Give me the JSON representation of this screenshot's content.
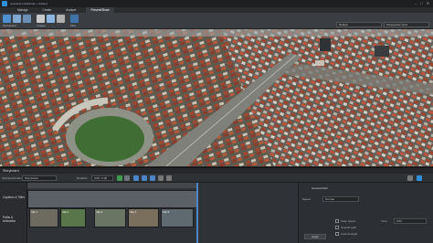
{
  "app": {
    "title": "Autodesk InfraWorks - Untitled"
  },
  "window_controls": [
    "–",
    "□",
    "✕"
  ],
  "ribbon": {
    "tabs": [
      {
        "label": "Manage",
        "active": false
      },
      {
        "label": "Create",
        "active": false
      },
      {
        "label": "Analyze",
        "active": false
      },
      {
        "label": "Present/Share",
        "active": true
      }
    ],
    "groups": [
      "Storyboard",
      "Images",
      "Misc"
    ],
    "style_select": "Default",
    "view_select": "Perspective View",
    "accent": "#2f8fd8"
  },
  "storyboard": {
    "title": "Storyboard",
    "name_label": "Storyboard Name:",
    "name_value": "Storyboard",
    "duration_label": "Duration:",
    "duration_value": "0:00 / 0:00",
    "tracks": [
      "Captions & Titles",
      "Paths & Animation"
    ],
    "thumb_labels": [
      "Clip 1",
      "Clip 2",
      "Clip 3",
      "Clip 4",
      "Clip 5"
    ],
    "properties": {
      "heading": "Camera Path",
      "speed_label": "Speed",
      "speed_value": "Normal",
      "options": [
        "Keep speed",
        "Smooth path",
        "Look at target"
      ],
      "time_label": "Time",
      "time_value": "0:00",
      "apply_label": "Apply"
    }
  }
}
